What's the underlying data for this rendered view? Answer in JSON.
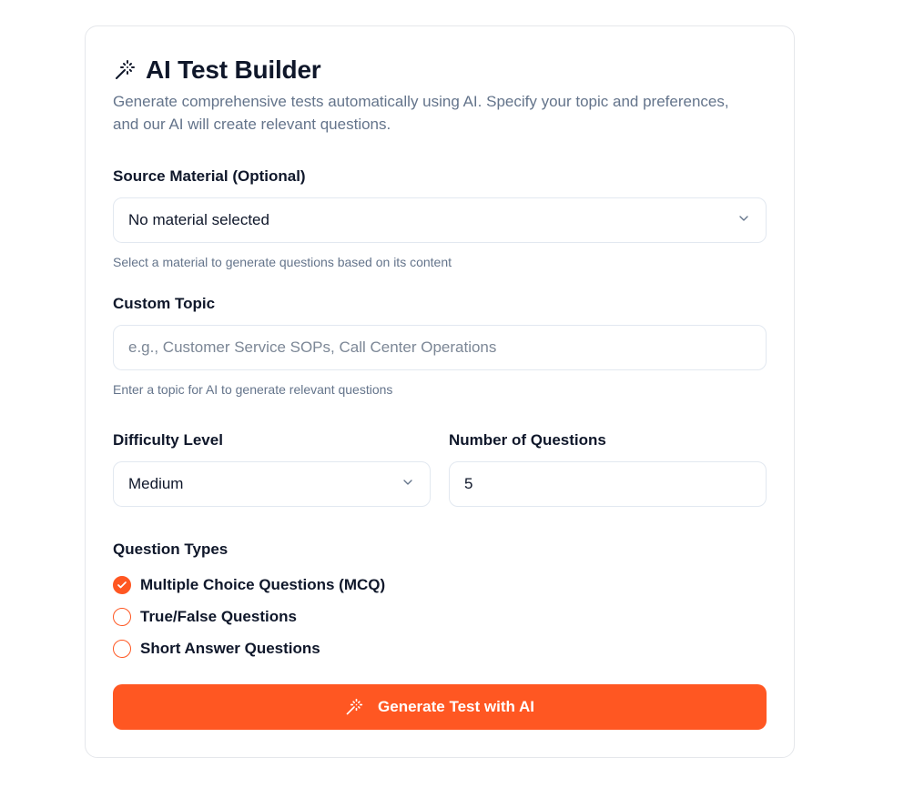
{
  "header": {
    "title": "AI Test Builder",
    "subtitle": "Generate comprehensive tests automatically using AI. Specify your topic and preferences, and our AI will create relevant questions.",
    "icon": "magic-wand-icon"
  },
  "source_material": {
    "label": "Source Material (Optional)",
    "selected": "No material selected",
    "hint": "Select a material to generate questions based on its content"
  },
  "custom_topic": {
    "label": "Custom Topic",
    "placeholder": "e.g., Customer Service SOPs, Call Center Operations",
    "value": "",
    "hint": "Enter a topic for AI to generate relevant questions"
  },
  "difficulty": {
    "label": "Difficulty Level",
    "selected": "Medium"
  },
  "num_questions": {
    "label": "Number of Questions",
    "value": "5"
  },
  "question_types": {
    "label": "Question Types",
    "items": [
      {
        "label": "Multiple Choice Questions (MCQ)",
        "checked": true
      },
      {
        "label": "True/False Questions",
        "checked": false
      },
      {
        "label": "Short Answer Questions",
        "checked": false
      }
    ]
  },
  "generate_button": {
    "label": "Generate Test with AI",
    "icon": "magic-wand-icon"
  },
  "colors": {
    "accent": "#ff5722",
    "text": "#0f172a",
    "muted": "#64748b",
    "border": "#e2e8f0"
  }
}
